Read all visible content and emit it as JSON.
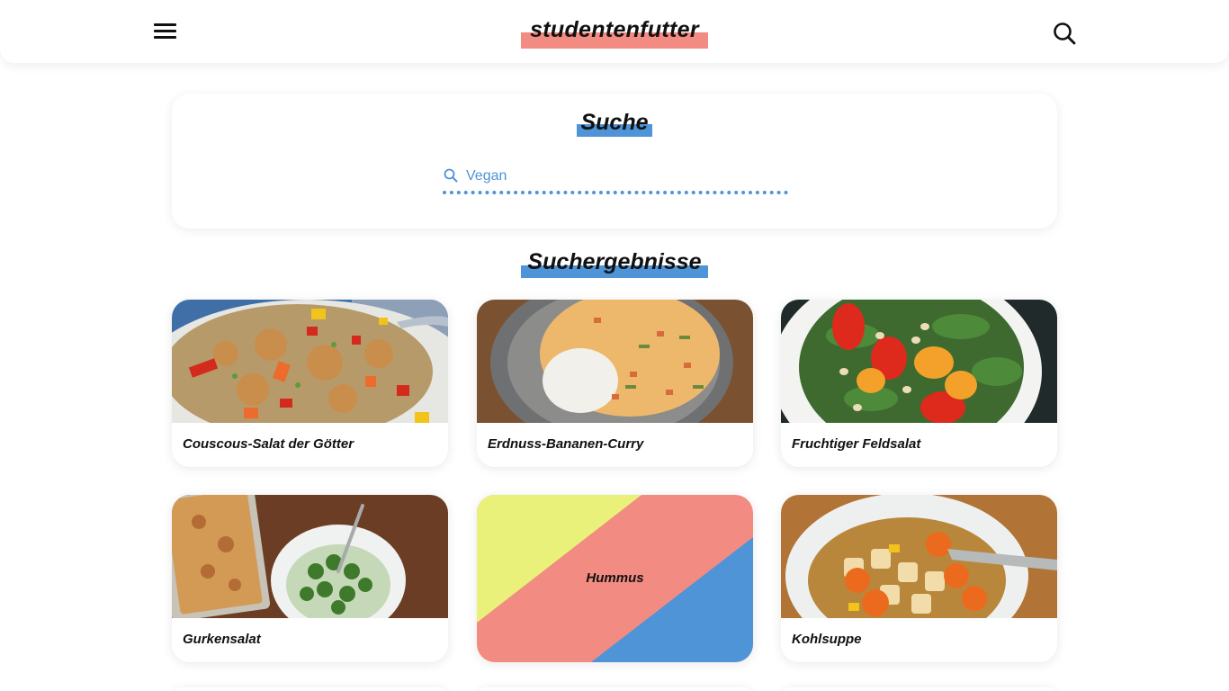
{
  "header": {
    "logo_text": "studentenfutter",
    "menu_icon": "hamburger-menu-icon",
    "search_icon": "search-icon"
  },
  "search": {
    "title": "Suche",
    "value": "Vegan",
    "placeholder": "Vegan"
  },
  "results": {
    "title": "Suchergebnisse",
    "items": [
      {
        "label": "Couscous-Salat der Götter"
      },
      {
        "label": "Erdnuss-Bananen-Curry"
      },
      {
        "label": "Fruchtiger Feldsalat"
      },
      {
        "label": "Gurkensalat"
      },
      {
        "label": "Hummus"
      },
      {
        "label": "Kohlsuppe"
      }
    ]
  },
  "colors": {
    "accent_red": "#f28b82",
    "accent_blue": "#4e94d7",
    "accent_yellow": "#e9f17a"
  }
}
